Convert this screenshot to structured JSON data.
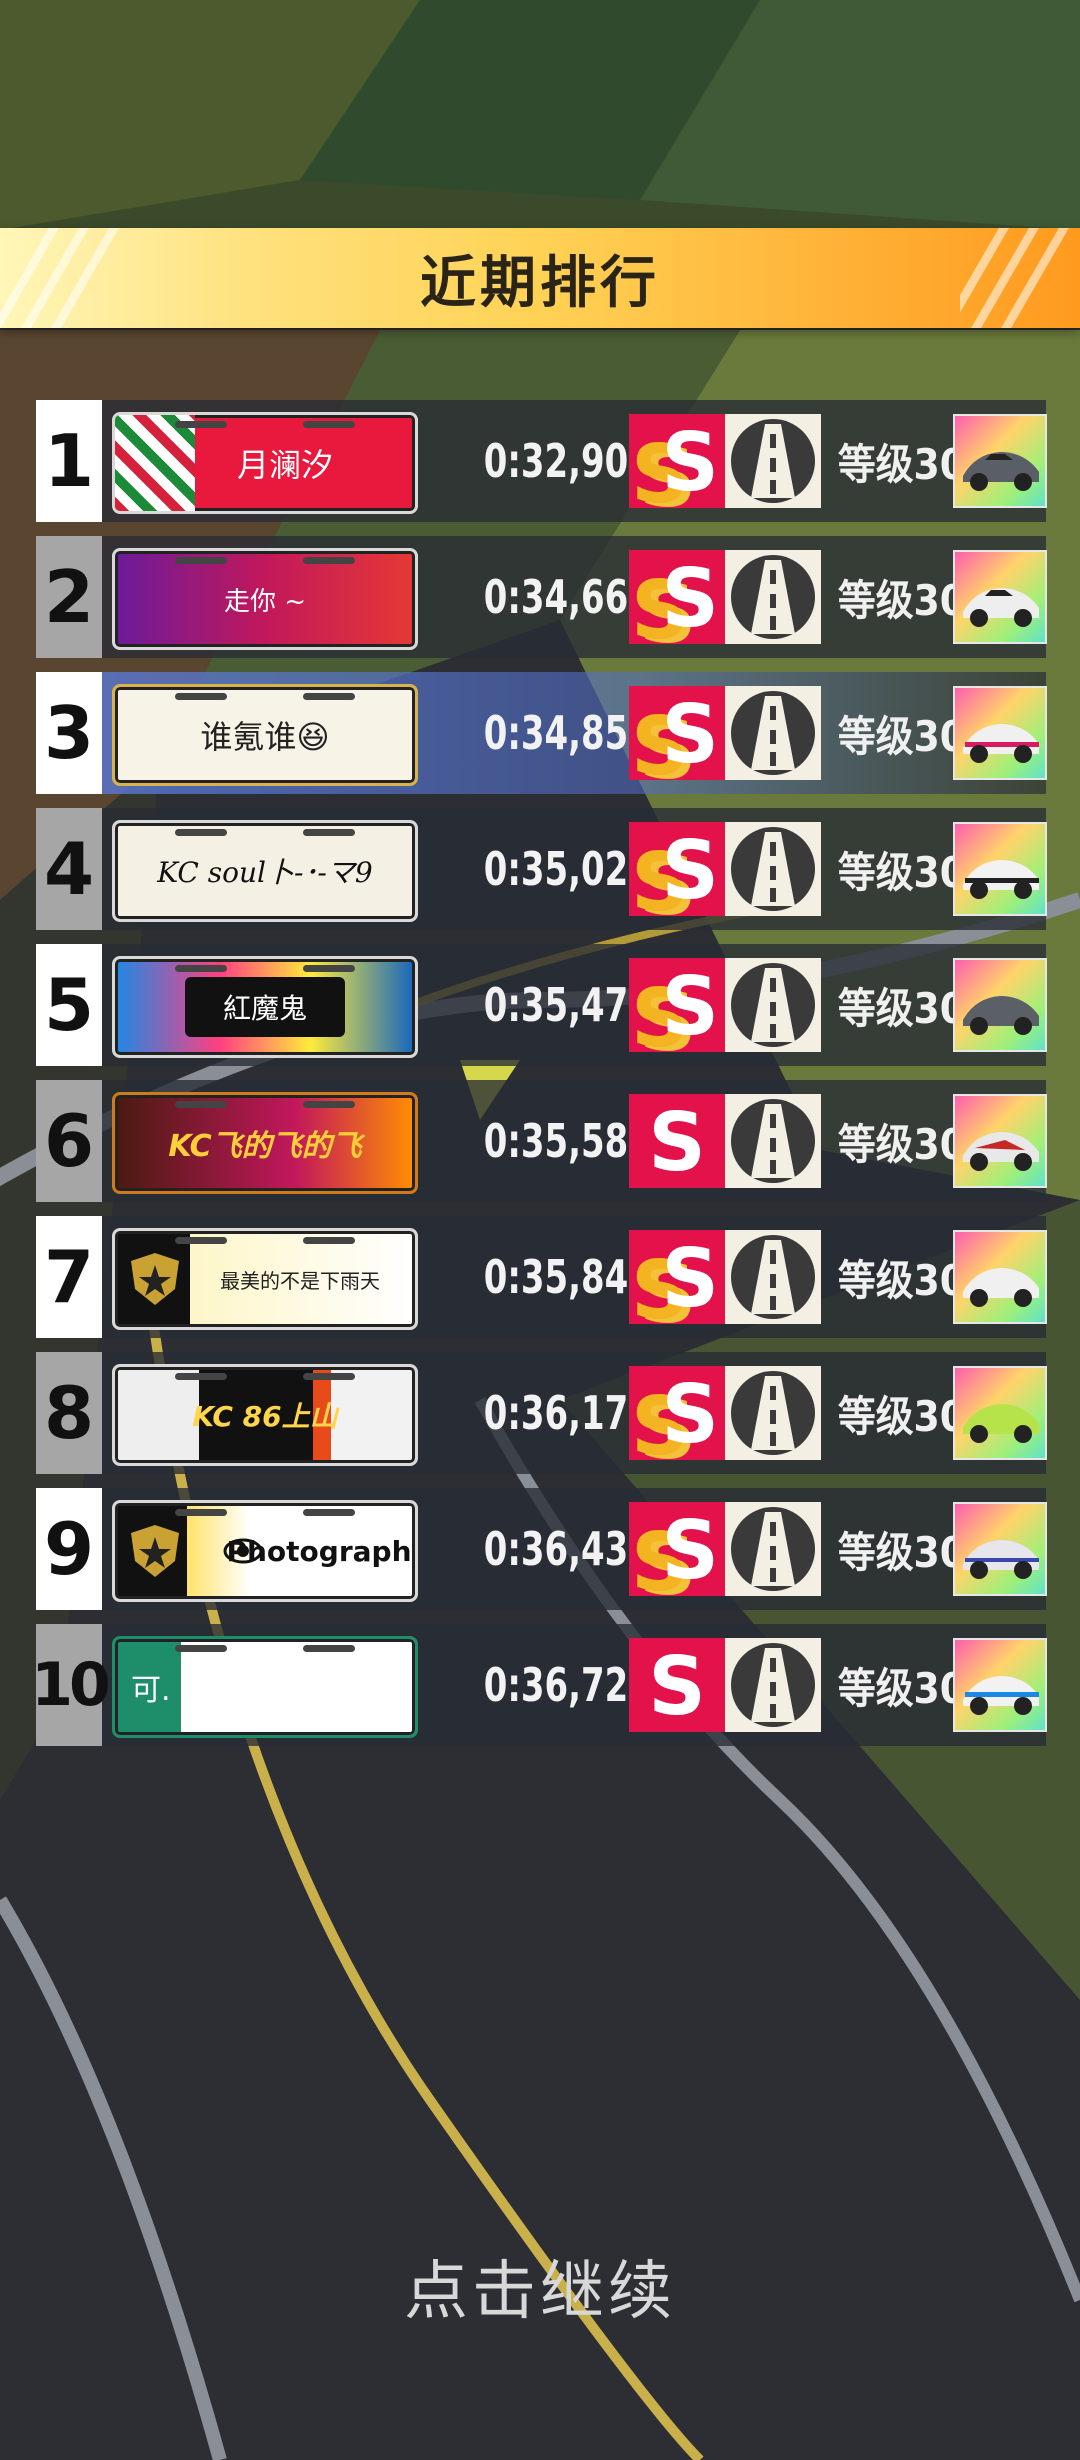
{
  "header": {
    "title": "近期排行"
  },
  "rows": [
    {
      "rank": "1",
      "plate": "月澜汐",
      "time": "0:32,90",
      "badge": "S",
      "level": "等级30"
    },
    {
      "rank": "2",
      "plate": "走你 ~",
      "time": "0:34,66",
      "badge": "S",
      "level": "等级30"
    },
    {
      "rank": "3",
      "plate": "谁氪谁😆",
      "time": "0:34,85",
      "badge": "S",
      "level": "等级30"
    },
    {
      "rank": "4",
      "plate": "KC soul卜-･-マ9",
      "time": "0:35,02",
      "badge": "S",
      "level": "等级30"
    },
    {
      "rank": "5",
      "plate": "紅魔鬼",
      "time": "0:35,47",
      "badge": "S",
      "level": "等级30"
    },
    {
      "rank": "6",
      "plate": "KC飞的飞的飞",
      "time": "0:35,58",
      "badge": "S",
      "level": "等级30"
    },
    {
      "rank": "7",
      "plate": "最美的不是下雨天",
      "time": "0:35,84",
      "badge": "S",
      "level": "等级30"
    },
    {
      "rank": "8",
      "plate": "KC 86上山",
      "time": "0:36,17",
      "badge": "S",
      "level": "等级30"
    },
    {
      "rank": "9",
      "plate": "Photograph",
      "time": "0:36,43",
      "badge": "S",
      "level": "等级30"
    },
    {
      "rank": "10",
      "plate": "可.",
      "time": "0:36,72",
      "badge": "S",
      "level": "等级30"
    }
  ],
  "footer": {
    "continue_label": "点击继续"
  }
}
